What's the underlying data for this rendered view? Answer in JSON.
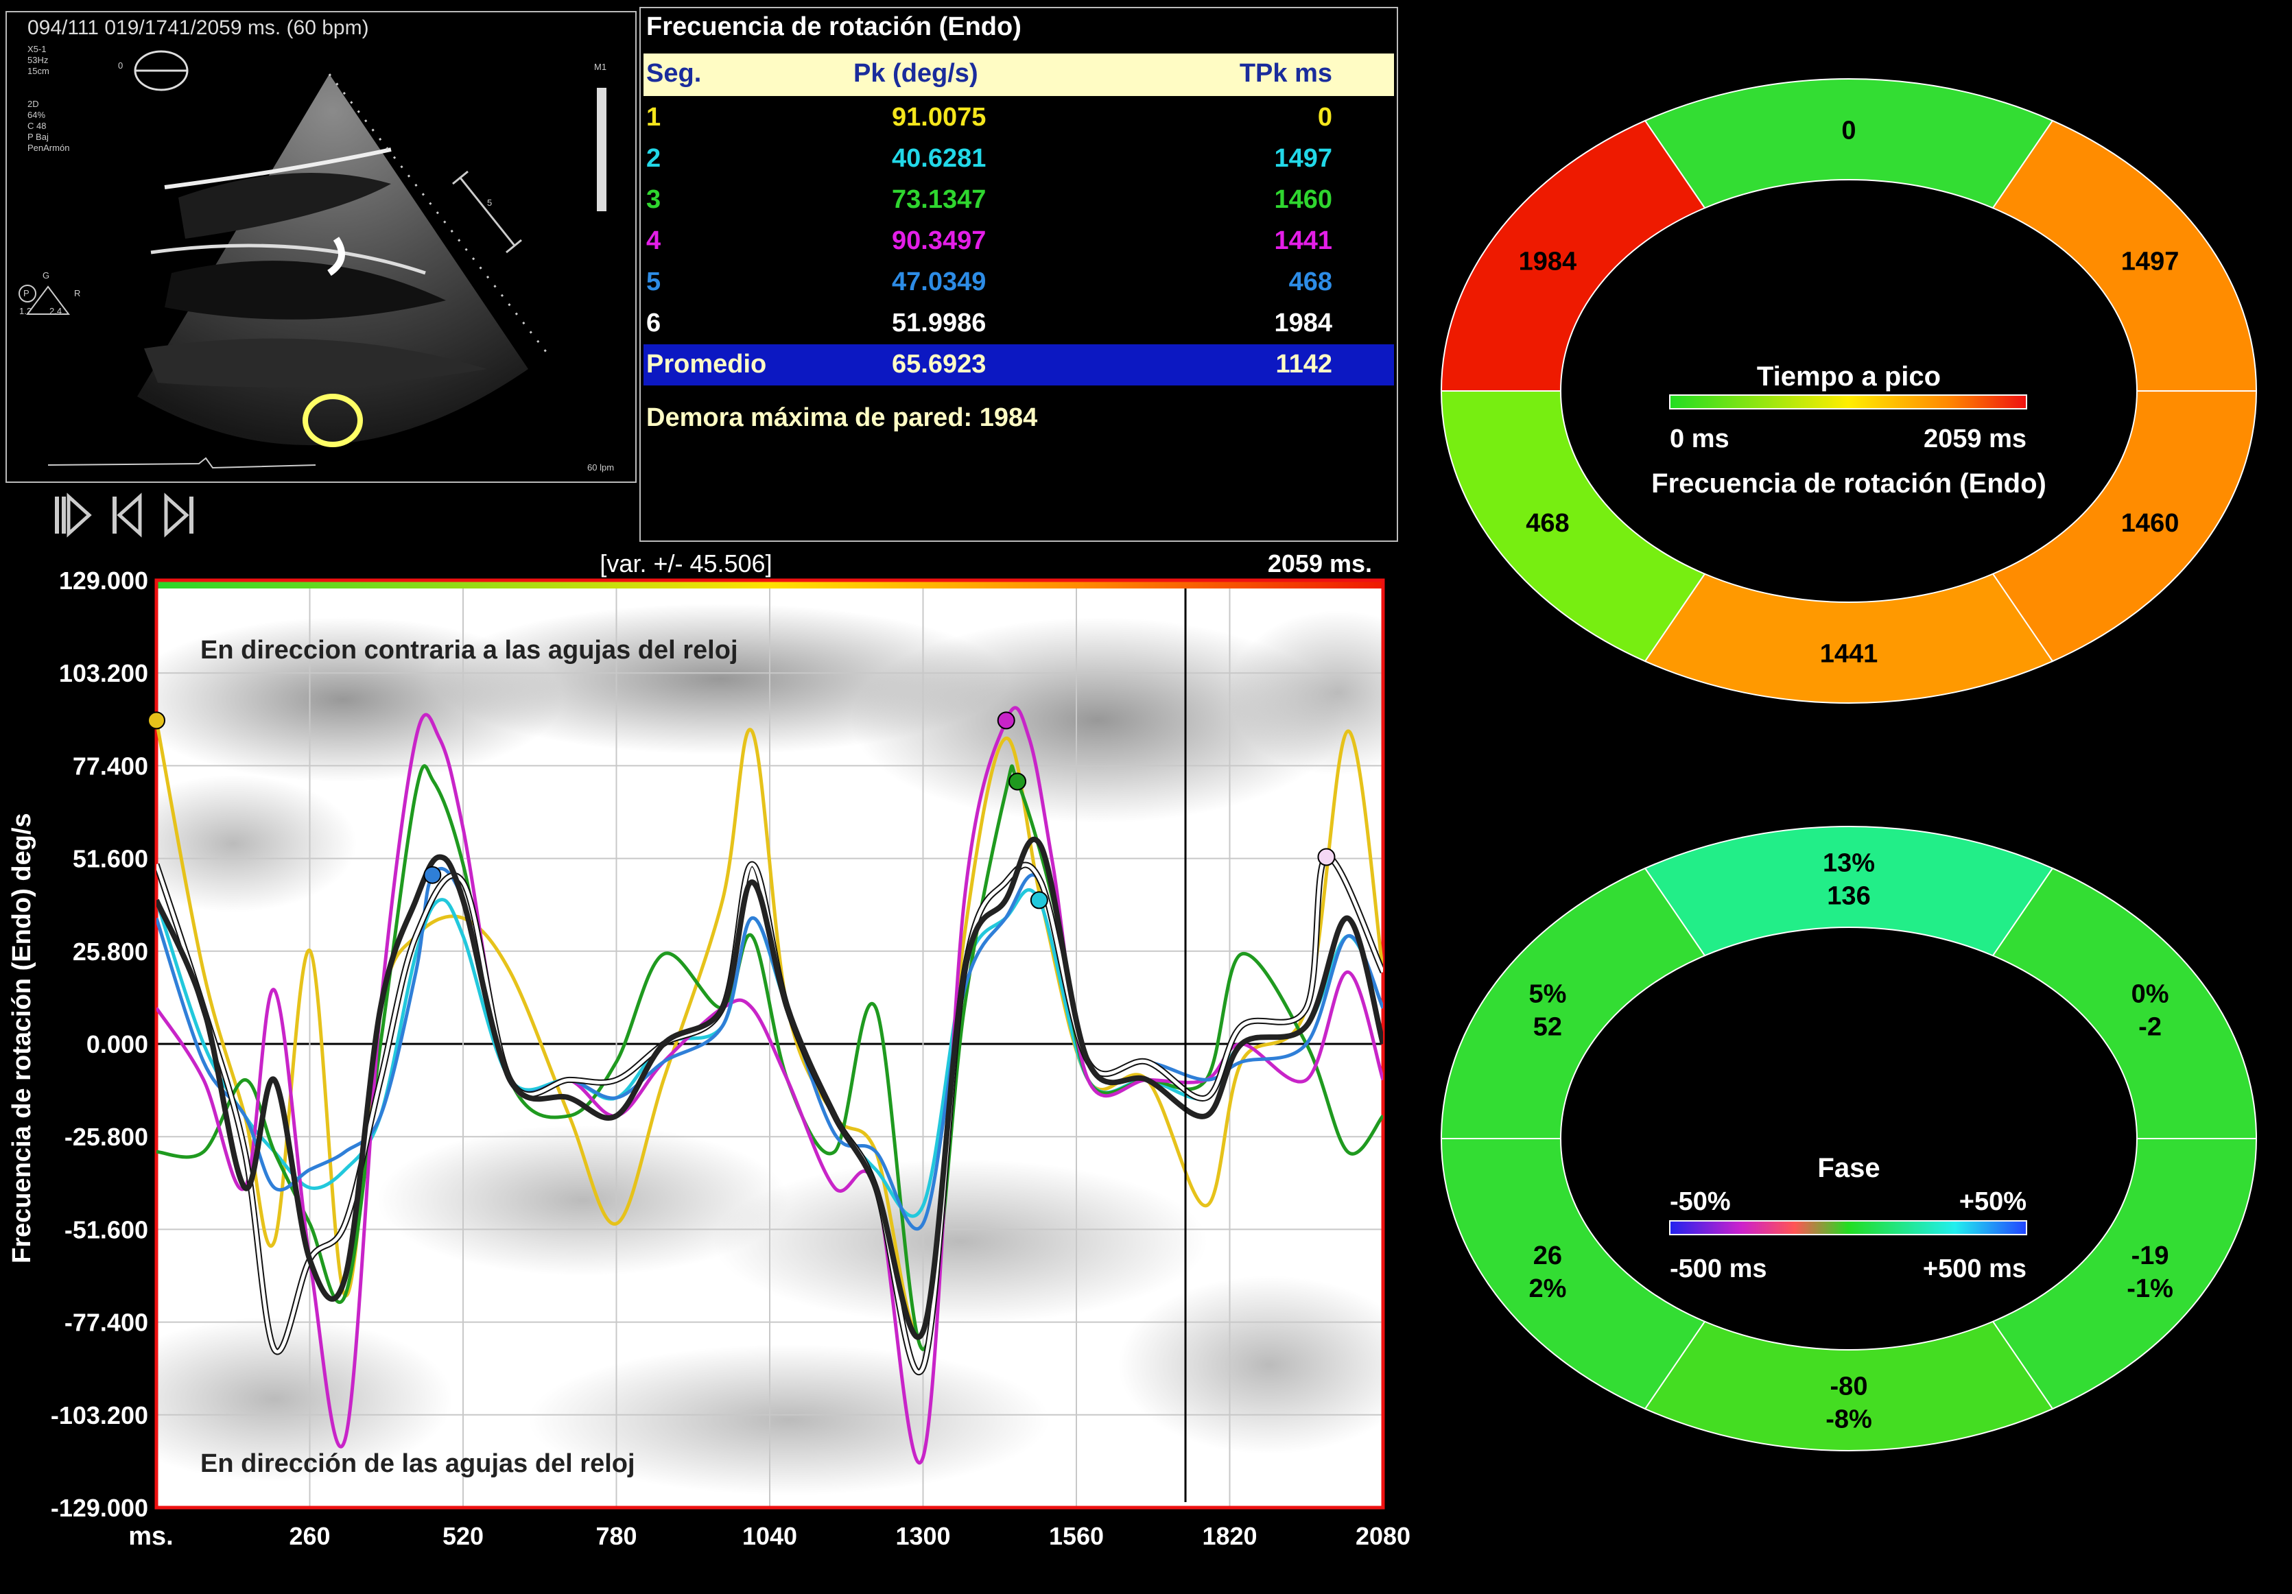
{
  "echo": {
    "header": "094/111  019/1741/2059 ms.  (60 bpm)",
    "marker_zero": "0",
    "probe_lines": [
      "X5-1",
      "53Hz",
      "15cm"
    ],
    "settings_lines": [
      "2D",
      "64%",
      "C 48",
      "P Baj",
      "PenArmón"
    ],
    "m1_label": "M1",
    "scale_label": "5",
    "orientation": {
      "g": "G",
      "p": "P",
      "r": "R",
      "v1": "1.2",
      "v2": "2.4"
    },
    "hr_label": "60 lpm"
  },
  "table": {
    "title": "Frecuencia de rotación (Endo)",
    "headers": {
      "seg": "Seg.",
      "pk": "Pk (deg/s)",
      "tpk": "TPk ms"
    },
    "rows": [
      {
        "seg": "1",
        "pk": "91.0075",
        "tpk": "0",
        "color": "#f5e61c"
      },
      {
        "seg": "2",
        "pk": "40.6281",
        "tpk": "1497",
        "color": "#22d8e8"
      },
      {
        "seg": "3",
        "pk": "73.1347",
        "tpk": "1460",
        "color": "#2fd62f"
      },
      {
        "seg": "4",
        "pk": "90.3497",
        "tpk": "1441",
        "color": "#e41ee8"
      },
      {
        "seg": "5",
        "pk": "47.0349",
        "tpk": "468",
        "color": "#2d8ce6"
      },
      {
        "seg": "6",
        "pk": "51.9986",
        "tpk": "1984",
        "color": "#ffffff"
      }
    ],
    "average": {
      "label": "Promedio",
      "pk": "65.6923",
      "tpk": "1142"
    },
    "max_delay": "Demora máxima de pared: 1984"
  },
  "controls": {
    "play_icon": "play-step-icon",
    "prev_icon": "previous-frame-icon",
    "next_icon": "next-frame-icon"
  },
  "chart_data": {
    "type": "line",
    "variance_label": "[var. +/- 45.506]",
    "duration_label": "2059 ms.",
    "ylabel": "Frecuencia de rotación (Endo)  deg/s",
    "xlabel": "ms.",
    "ytick_labels": [
      "129.000",
      "103.200",
      "77.400",
      "51.600",
      "25.800",
      "0.000",
      "-25.800",
      "-51.600",
      "-77.400",
      "-103.200",
      "-129.000"
    ],
    "xtick_labels": [
      "260",
      "520",
      "780",
      "1040",
      "1300",
      "1560",
      "1820",
      "2080"
    ],
    "xticks": [
      260,
      520,
      780,
      1040,
      1300,
      1560,
      1820,
      2080
    ],
    "ylim": [
      -129,
      129
    ],
    "xlim": [
      0,
      2080
    ],
    "annotation_top": "En direccion contraria a las agujas del reloj",
    "annotation_bottom": "En dirección de las agujas del reloj",
    "cursor_x": 1745,
    "series": [
      {
        "name": "1",
        "color": "#e6c21a",
        "values": [
          [
            0,
            90
          ],
          [
            80,
            20
          ],
          [
            150,
            -20
          ],
          [
            200,
            -55
          ],
          [
            260,
            26
          ],
          [
            320,
            -70
          ],
          [
            380,
            10
          ],
          [
            440,
            30
          ],
          [
            520,
            35
          ],
          [
            600,
            20
          ],
          [
            700,
            -20
          ],
          [
            780,
            -50
          ],
          [
            860,
            -10
          ],
          [
            960,
            40
          ],
          [
            1010,
            87
          ],
          [
            1070,
            10
          ],
          [
            1150,
            -20
          ],
          [
            1220,
            -30
          ],
          [
            1300,
            -80
          ],
          [
            1370,
            30
          ],
          [
            1440,
            85
          ],
          [
            1500,
            40
          ],
          [
            1580,
            -10
          ],
          [
            1680,
            -10
          ],
          [
            1780,
            -45
          ],
          [
            1840,
            -5
          ],
          [
            1950,
            10
          ],
          [
            2020,
            87
          ],
          [
            2080,
            20
          ]
        ],
        "peak": [
          0,
          90
        ]
      },
      {
        "name": "2",
        "color": "#22c8dc",
        "values": [
          [
            0,
            40
          ],
          [
            80,
            0
          ],
          [
            150,
            -20
          ],
          [
            200,
            -30
          ],
          [
            260,
            -40
          ],
          [
            320,
            -35
          ],
          [
            380,
            -20
          ],
          [
            440,
            25
          ],
          [
            480,
            40
          ],
          [
            520,
            30
          ],
          [
            600,
            -10
          ],
          [
            700,
            -10
          ],
          [
            780,
            -15
          ],
          [
            860,
            0
          ],
          [
            960,
            5
          ],
          [
            1010,
            35
          ],
          [
            1070,
            10
          ],
          [
            1150,
            -20
          ],
          [
            1220,
            -35
          ],
          [
            1300,
            -45
          ],
          [
            1370,
            20
          ],
          [
            1440,
            35
          ],
          [
            1497,
            40
          ],
          [
            1580,
            -10
          ],
          [
            1680,
            -10
          ],
          [
            1780,
            -15
          ],
          [
            1840,
            0
          ],
          [
            1950,
            5
          ],
          [
            2020,
            30
          ],
          [
            2080,
            10
          ]
        ],
        "peak": [
          1497,
          40
        ]
      },
      {
        "name": "3",
        "color": "#1f9a1f",
        "values": [
          [
            0,
            -30
          ],
          [
            80,
            -30
          ],
          [
            150,
            -10
          ],
          [
            200,
            -30
          ],
          [
            260,
            -50
          ],
          [
            320,
            -70
          ],
          [
            380,
            0
          ],
          [
            440,
            70
          ],
          [
            470,
            73
          ],
          [
            520,
            50
          ],
          [
            600,
            -10
          ],
          [
            700,
            -20
          ],
          [
            780,
            -5
          ],
          [
            860,
            25
          ],
          [
            960,
            10
          ],
          [
            1010,
            30
          ],
          [
            1070,
            -10
          ],
          [
            1150,
            -30
          ],
          [
            1220,
            10
          ],
          [
            1300,
            -85
          ],
          [
            1370,
            10
          ],
          [
            1440,
            70
          ],
          [
            1460,
            73
          ],
          [
            1520,
            40
          ],
          [
            1580,
            -10
          ],
          [
            1680,
            -10
          ],
          [
            1780,
            -10
          ],
          [
            1840,
            25
          ],
          [
            1950,
            0
          ],
          [
            2020,
            -30
          ],
          [
            2080,
            -20
          ]
        ],
        "peak": [
          1460,
          73
        ]
      },
      {
        "name": "4",
        "color": "#c824c8",
        "values": [
          [
            0,
            10
          ],
          [
            80,
            -10
          ],
          [
            150,
            -40
          ],
          [
            200,
            15
          ],
          [
            260,
            -60
          ],
          [
            320,
            -110
          ],
          [
            380,
            10
          ],
          [
            440,
            85
          ],
          [
            480,
            85
          ],
          [
            520,
            60
          ],
          [
            600,
            -10
          ],
          [
            700,
            -10
          ],
          [
            780,
            -20
          ],
          [
            860,
            -5
          ],
          [
            960,
            10
          ],
          [
            1010,
            10
          ],
          [
            1070,
            -10
          ],
          [
            1150,
            -40
          ],
          [
            1220,
            -40
          ],
          [
            1300,
            -115
          ],
          [
            1370,
            40
          ],
          [
            1441,
            90
          ],
          [
            1480,
            85
          ],
          [
            1520,
            50
          ],
          [
            1580,
            -10
          ],
          [
            1680,
            -10
          ],
          [
            1780,
            -10
          ],
          [
            1840,
            0
          ],
          [
            1950,
            -10
          ],
          [
            2020,
            20
          ],
          [
            2080,
            -10
          ]
        ],
        "peak": [
          1441,
          90
        ]
      },
      {
        "name": "5",
        "color": "#2f7fd8",
        "values": [
          [
            0,
            35
          ],
          [
            80,
            -5
          ],
          [
            150,
            -20
          ],
          [
            200,
            -40
          ],
          [
            260,
            -35
          ],
          [
            320,
            -30
          ],
          [
            380,
            -20
          ],
          [
            440,
            20
          ],
          [
            468,
            47
          ],
          [
            520,
            40
          ],
          [
            600,
            -10
          ],
          [
            700,
            -10
          ],
          [
            780,
            -15
          ],
          [
            860,
            -5
          ],
          [
            960,
            5
          ],
          [
            1010,
            35
          ],
          [
            1070,
            10
          ],
          [
            1150,
            -25
          ],
          [
            1220,
            -30
          ],
          [
            1300,
            -50
          ],
          [
            1370,
            15
          ],
          [
            1440,
            35
          ],
          [
            1500,
            45
          ],
          [
            1580,
            -5
          ],
          [
            1680,
            -5
          ],
          [
            1780,
            -10
          ],
          [
            1840,
            -5
          ],
          [
            1950,
            0
          ],
          [
            2020,
            30
          ],
          [
            2080,
            10
          ]
        ],
        "peak": [
          468,
          47
        ]
      },
      {
        "name": "6",
        "color": "#ffffff",
        "values": [
          [
            0,
            50
          ],
          [
            80,
            10
          ],
          [
            150,
            -30
          ],
          [
            200,
            -85
          ],
          [
            260,
            -60
          ],
          [
            320,
            -50
          ],
          [
            380,
            -10
          ],
          [
            440,
            30
          ],
          [
            520,
            45
          ],
          [
            600,
            -10
          ],
          [
            700,
            -10
          ],
          [
            780,
            -10
          ],
          [
            860,
            0
          ],
          [
            960,
            10
          ],
          [
            1010,
            50
          ],
          [
            1070,
            10
          ],
          [
            1150,
            -20
          ],
          [
            1220,
            -40
          ],
          [
            1300,
            -90
          ],
          [
            1370,
            20
          ],
          [
            1440,
            45
          ],
          [
            1500,
            45
          ],
          [
            1580,
            -5
          ],
          [
            1680,
            -5
          ],
          [
            1780,
            -15
          ],
          [
            1840,
            5
          ],
          [
            1950,
            10
          ],
          [
            1984,
            52
          ],
          [
            2080,
            20
          ]
        ],
        "peak": [
          1984,
          52
        ]
      },
      {
        "name": "Promedio",
        "color": "#222222",
        "values": [
          [
            0,
            40
          ],
          [
            80,
            10
          ],
          [
            150,
            -40
          ],
          [
            200,
            -10
          ],
          [
            260,
            -60
          ],
          [
            320,
            -65
          ],
          [
            380,
            10
          ],
          [
            440,
            40
          ],
          [
            480,
            52
          ],
          [
            520,
            40
          ],
          [
            600,
            -10
          ],
          [
            700,
            -15
          ],
          [
            780,
            -20
          ],
          [
            860,
            0
          ],
          [
            960,
            10
          ],
          [
            1010,
            45
          ],
          [
            1070,
            10
          ],
          [
            1150,
            -20
          ],
          [
            1220,
            -40
          ],
          [
            1300,
            -80
          ],
          [
            1370,
            20
          ],
          [
            1440,
            40
          ],
          [
            1500,
            55
          ],
          [
            1580,
            -5
          ],
          [
            1680,
            -10
          ],
          [
            1780,
            -20
          ],
          [
            1840,
            0
          ],
          [
            1950,
            5
          ],
          [
            2020,
            35
          ],
          [
            2080,
            0
          ]
        ]
      }
    ]
  },
  "bullseye_time": {
    "title": "Tiempo a pico",
    "scale_min": "0 ms",
    "scale_max": "2059 ms",
    "subtitle": "Frecuencia de rotación (Endo)",
    "segments": [
      {
        "label": "0",
        "color": "#33dd33"
      },
      {
        "label": "1497",
        "color": "#ff8c00"
      },
      {
        "label": "1460",
        "color": "#ff8c00"
      },
      {
        "label": "1441",
        "color": "#ff9900"
      },
      {
        "label": "468",
        "color": "#77ee11"
      },
      {
        "label": "1984",
        "color": "#ee1a00"
      }
    ]
  },
  "bullseye_phase": {
    "title": "Fase",
    "pct_min": "-50%",
    "pct_max": "+50%",
    "ms_min": "-500 ms",
    "ms_max": "+500 ms",
    "segments": [
      {
        "value": "136",
        "pct": "13%",
        "color": "#22ee88"
      },
      {
        "value": "-2",
        "pct": "0%",
        "color": "#33dd33"
      },
      {
        "value": "-19",
        "pct": "-1%",
        "color": "#33dd33"
      },
      {
        "value": "-80",
        "pct": "-8%",
        "color": "#44dd22"
      },
      {
        "value": "26",
        "pct": "2%",
        "color": "#33dd33"
      },
      {
        "value": "52",
        "pct": "5%",
        "color": "#33dd33"
      }
    ]
  }
}
